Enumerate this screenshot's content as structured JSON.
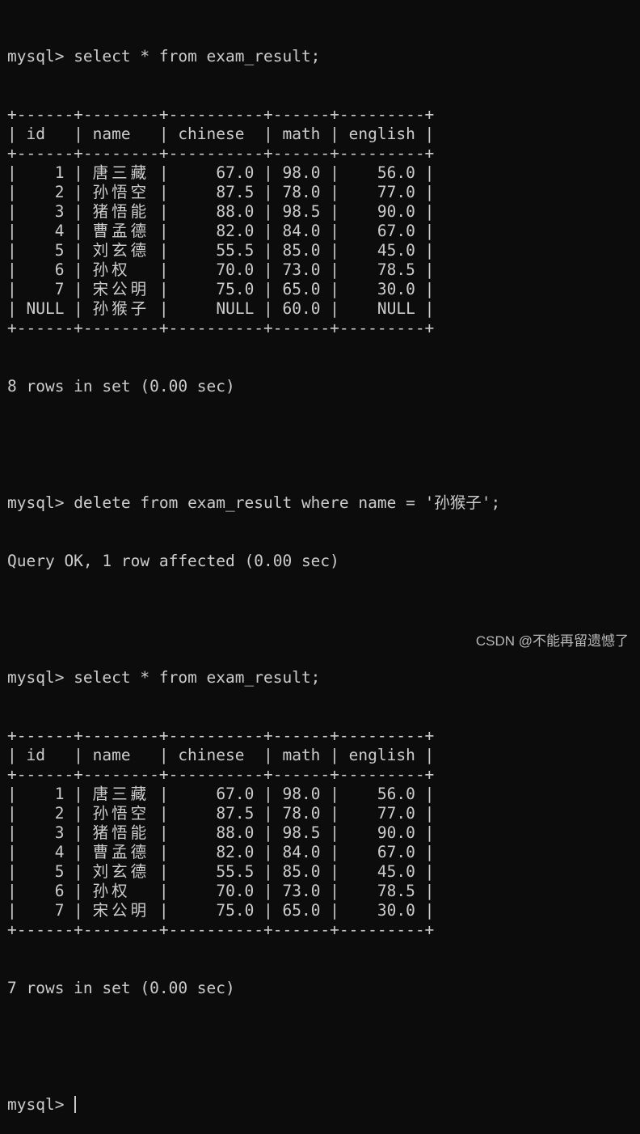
{
  "terminal": {
    "prompt": "mysql> ",
    "commands": {
      "select1": "select * from exam_result;",
      "delete": "delete from exam_result where name = '孙猴子';",
      "select2": "select * from exam_result;"
    },
    "table_border": "+------+--------+----------+------+---------+",
    "columns": [
      "id",
      "name",
      "chinese",
      "math",
      "english"
    ],
    "table1_rows": [
      [
        "1",
        "唐三藏",
        "67.0",
        "98.0",
        "56.0"
      ],
      [
        "2",
        "孙悟空",
        "87.5",
        "78.0",
        "77.0"
      ],
      [
        "3",
        "猪悟能",
        "88.0",
        "98.5",
        "90.0"
      ],
      [
        "4",
        "曹孟德",
        "82.0",
        "84.0",
        "67.0"
      ],
      [
        "5",
        "刘玄德",
        "55.5",
        "85.0",
        "45.0"
      ],
      [
        "6",
        "孙权",
        "70.0",
        "73.0",
        "78.5"
      ],
      [
        "7",
        "宋公明",
        "75.0",
        "65.0",
        "30.0"
      ],
      [
        "NULL",
        "孙猴子",
        "NULL",
        "60.0",
        "NULL"
      ]
    ],
    "table1_status": "8 rows in set (0.00 sec)",
    "delete_status": "Query OK, 1 row affected (0.00 sec)",
    "table2_rows": [
      [
        "1",
        "唐三藏",
        "67.0",
        "98.0",
        "56.0"
      ],
      [
        "2",
        "孙悟空",
        "87.5",
        "78.0",
        "77.0"
      ],
      [
        "3",
        "猪悟能",
        "88.0",
        "98.5",
        "90.0"
      ],
      [
        "4",
        "曹孟德",
        "82.0",
        "84.0",
        "67.0"
      ],
      [
        "5",
        "刘玄德",
        "55.5",
        "85.0",
        "45.0"
      ],
      [
        "6",
        "孙权",
        "70.0",
        "73.0",
        "78.5"
      ],
      [
        "7",
        "宋公明",
        "75.0",
        "65.0",
        "30.0"
      ]
    ],
    "table2_status": "7 rows in set (0.00 sec)"
  },
  "watermark": "CSDN @不能再留遗憾了"
}
